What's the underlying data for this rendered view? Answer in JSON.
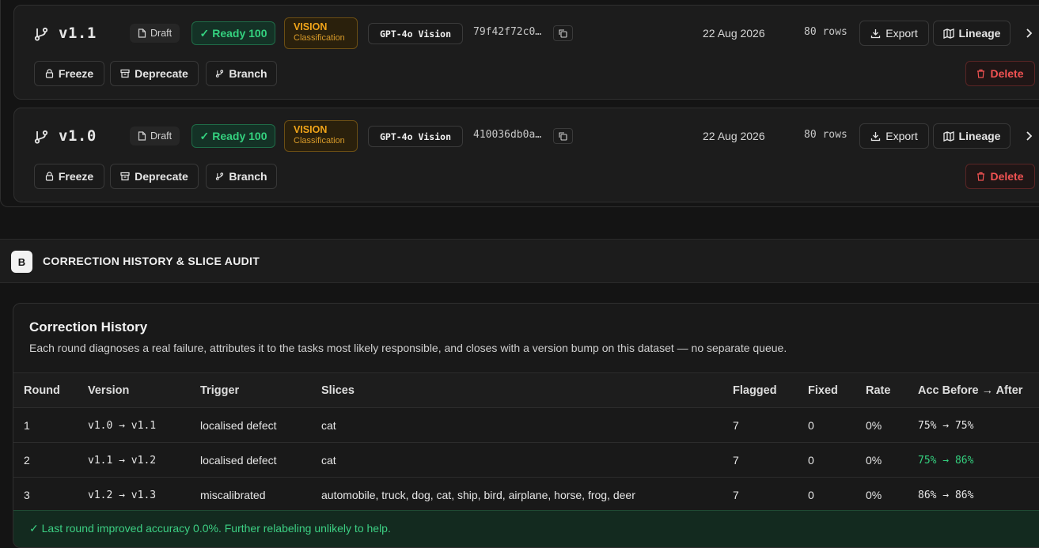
{
  "versions": [
    {
      "label": "v1.1",
      "draft": "Draft",
      "ready": "Ready 100",
      "task_type": "VISION",
      "task_sub": "Classification",
      "model": "GPT-4o Vision",
      "hash": "79f42f72c0…",
      "date": "22 Aug 2026",
      "rows": "80 rows",
      "export": "Export",
      "lineage": "Lineage",
      "freeze": "Freeze",
      "deprecate": "Deprecate",
      "branch": "Branch",
      "delete": "Delete"
    },
    {
      "label": "v1.0",
      "draft": "Draft",
      "ready": "Ready 100",
      "task_type": "VISION",
      "task_sub": "Classification",
      "model": "GPT-4o Vision",
      "hash": "410036db0a…",
      "date": "22 Aug 2026",
      "rows": "80 rows",
      "export": "Export",
      "lineage": "Lineage",
      "freeze": "Freeze",
      "deprecate": "Deprecate",
      "branch": "Branch",
      "delete": "Delete"
    }
  ],
  "section_b": {
    "badge": "B",
    "title": "CORRECTION HISTORY & SLICE AUDIT"
  },
  "correction_history": {
    "title": "Correction History",
    "description": "Each round diagnoses a real failure, attributes it to the tasks most likely responsible, and closes with a version bump on this dataset — no separate queue.",
    "columns": [
      "Round",
      "Version",
      "Trigger",
      "Slices",
      "Flagged",
      "Fixed",
      "Rate",
      "Acc Before → After"
    ],
    "rows": [
      {
        "round": "1",
        "version": "v1.0 → v1.1",
        "trigger": "localised defect",
        "slices": "cat",
        "flagged": "7",
        "fixed": "0",
        "rate": "0%",
        "acc": "75% → 75%",
        "improved": false
      },
      {
        "round": "2",
        "version": "v1.1 → v1.2",
        "trigger": "localised defect",
        "slices": "cat",
        "flagged": "7",
        "fixed": "0",
        "rate": "0%",
        "acc": "75% → 86%",
        "improved": true
      },
      {
        "round": "3",
        "version": "v1.2 → v1.3",
        "trigger": "miscalibrated",
        "slices": "automobile, truck, dog, cat, ship, bird, airplane, horse, frog, deer",
        "flagged": "7",
        "fixed": "0",
        "rate": "0%",
        "acc": "86% → 86%",
        "improved": false
      }
    ],
    "footer": "✓ Last round improved accuracy 0.0%. Further relabeling unlikely to help."
  },
  "colors": {
    "ready_green": "#34d17f",
    "vision_amber": "#f0a419",
    "delete_red": "#f05252"
  }
}
